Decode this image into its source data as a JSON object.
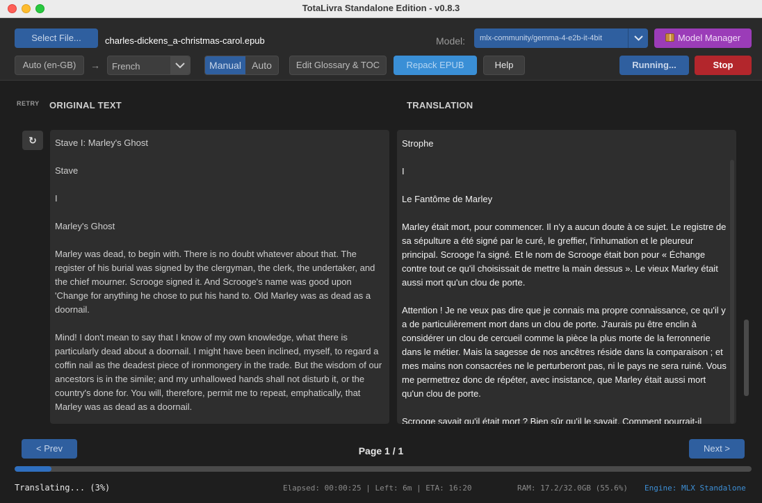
{
  "window": {
    "title": "TotaLivra Standalone Edition - v0.8.3"
  },
  "toolbar": {
    "select_file_label": "Select File...",
    "file_name": "charles-dickens_a-christmas-carol.epub",
    "model_label": "Model:",
    "model_value": "mlx-community/gemma-4-e2b-it-4bit",
    "model_manager_label": "Model Manager",
    "source_lang": "Auto (en-GB)",
    "arrow": "→",
    "target_lang": "French",
    "mode_manual": "Manual",
    "mode_auto": "Auto",
    "edit_glossary_label": "Edit Glossary & TOC",
    "repack_label": "Repack EPUB",
    "help_label": "Help",
    "running_label": "Running...",
    "stop_label": "Stop",
    "colors": {
      "accent_blue": "#2f5f9f",
      "stop_red": "#b3262c",
      "model_manager_purple": "#9b3cb8",
      "repack_blue": "#3a8fd6"
    },
    "icons": {
      "model_select": "chevron-down-icon",
      "target_lang": "chevron-down-icon",
      "model_manager": "box-icon"
    }
  },
  "headers": {
    "retry": "RETRY",
    "original": "ORIGINAL TEXT",
    "translation": "TRANSLATION"
  },
  "retry_icon": "↻",
  "original_paragraphs": [
    "Stave I: Marley's Ghost",
    "Stave",
    "I",
    "Marley's Ghost",
    "Marley was dead, to begin with. There is no doubt whatever about that. The register of his burial was signed by the clergyman, the clerk, the undertaker, and the chief mourner. Scrooge signed it. And Scrooge's name was good upon 'Change for anything he chose to put his hand to. Old Marley was as dead as a doornail.",
    "Mind! I don't mean to say that I know of my own knowledge, what there is particularly dead about a doornail. I might have been inclined, myself, to regard a coffin nail as the deadest piece of ironmongery in the trade. But the wisdom of our ancestors is in the simile; and my unhallowed hands shall not disturb it, or the country's done for. You will, therefore, permit me to repeat, emphatically, that Marley was as dead as a doornail."
  ],
  "translation_paragraphs": [
    "Strophe",
    "I",
    "Le Fantôme de Marley",
    "Marley était mort, pour commencer. Il n'y a aucun doute à ce sujet. Le registre de sa sépulture a été signé par le curé, le greffier, l'inhumation et le pleureur principal. Scrooge l'a signé. Et le nom de Scrooge était bon pour « Échange contre tout ce qu'il choisissait de mettre la main dessus ». Le vieux Marley était aussi mort qu'un clou de porte.",
    "Attention ! Je ne veux pas dire que je connais ma propre connaissance, ce qu'il y a de particulièrement mort dans un clou de porte. J'aurais pu être enclin à considérer un clou de cercueil comme la pièce la plus morte de la ferronnerie dans le métier. Mais la sagesse de nos ancêtres réside dans la comparaison ; et mes mains non consacrées ne le perturberont pas, ni le pays ne sera ruiné. Vous me permettrez donc de répéter, avec insistance, que Marley était aussi mort qu'un clou de porte.",
    "Scrooge savait qu'il était mort ? Bien sûr qu'il le savait. Comment pourrait-il"
  ],
  "pagination": {
    "prev_label": "< Prev",
    "page_label": "Page 1 / 1",
    "next_label": "Next >"
  },
  "progress": {
    "percent": 3
  },
  "status": {
    "translating": "Translating... (3%)",
    "timing": "Elapsed: 00:00:25 | Left: 6m | ETA: 16:20",
    "ram": "RAM: 17.2/32.0GB (55.6%)",
    "engine": "Engine: MLX Standalone"
  }
}
